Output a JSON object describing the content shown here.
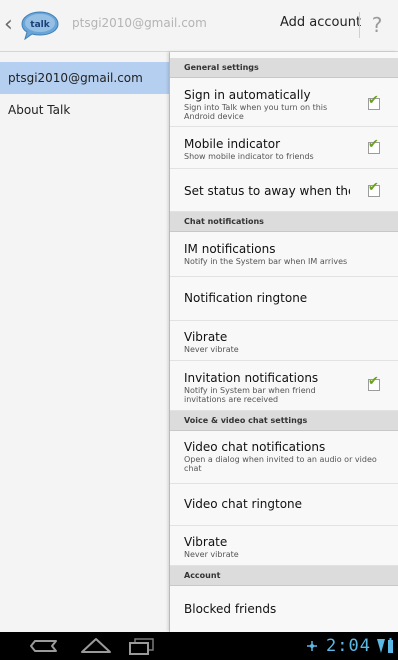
{
  "header": {
    "back_icon": "chevron-left-icon",
    "logo_text": "talk",
    "account_title": "ptsgi2010@gmail.com",
    "add_account_label": "Add account",
    "help_icon": "question-mark-icon"
  },
  "sidebar": {
    "items": [
      {
        "label": "ptsgi2010@gmail.com",
        "selected": true
      },
      {
        "label": "About Talk",
        "selected": false
      }
    ]
  },
  "settings": {
    "general_header": "General settings",
    "sign_in": {
      "title": "Sign in automatically",
      "summary": "Sign into Talk when you turn on this Android device",
      "checked": true
    },
    "mobile_indicator": {
      "title": "Mobile indicator",
      "summary": "Show mobile indicator to friends",
      "checked": true
    },
    "away_status": {
      "title": "Set status to away when the screen is turned off",
      "checked": true
    },
    "chat_header": "Chat notifications",
    "im_notifications": {
      "title": "IM notifications",
      "summary": "Notify in the System bar when IM arrives"
    },
    "notification_ringtone": {
      "title": "Notification ringtone"
    },
    "vibrate": {
      "title": "Vibrate",
      "summary": "Never vibrate"
    },
    "invitation_notifications": {
      "title": "Invitation notifications",
      "summary": "Notify in System bar when friend invitations are received",
      "checked": true
    },
    "voice_header": "Voice & video chat settings",
    "video_chat_notifications": {
      "title": "Video chat notifications",
      "summary": "Open a dialog when invited to an audio or video chat"
    },
    "video_chat_ringtone": {
      "title": "Video chat ringtone"
    },
    "video_vibrate": {
      "title": "Vibrate",
      "summary": "Never vibrate"
    },
    "account_header": "Account",
    "blocked_friends": {
      "title": "Blocked friends"
    }
  },
  "system_bar": {
    "back_icon": "back-icon",
    "home_icon": "home-icon",
    "recent_apps_icon": "recent-apps-icon",
    "clock": "2:04",
    "colors": {
      "clock": "#5bb9e6"
    }
  },
  "colors": {
    "accent_check": "#6aa120",
    "selected_row": "#b5cff0"
  }
}
